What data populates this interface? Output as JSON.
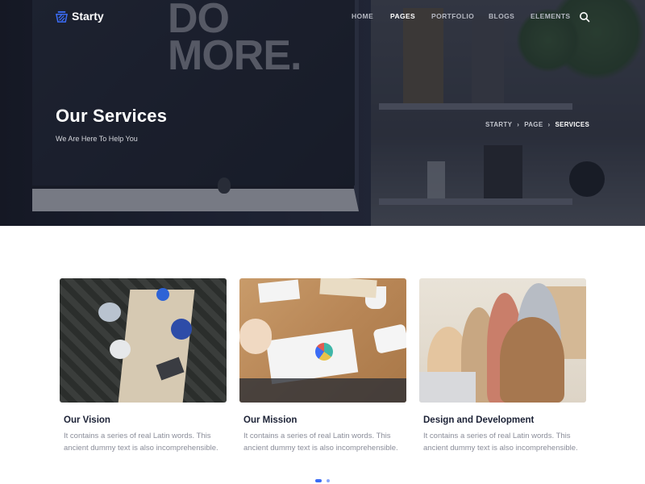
{
  "brand": {
    "name": "Starty",
    "accent": "#3b6cf5"
  },
  "nav": {
    "items": [
      {
        "label": "HOME",
        "active": false
      },
      {
        "label": "PAGES",
        "active": true
      },
      {
        "label": "PORTFOLIO",
        "active": false
      },
      {
        "label": "BLOGS",
        "active": false
      },
      {
        "label": "ELEMENTS",
        "active": false
      }
    ],
    "search_icon": "search-icon"
  },
  "hero": {
    "title": "Our Services",
    "subtitle": "We Are Here To Help You",
    "poster_text": "DO\nMORE.",
    "breadcrumb": [
      {
        "label": "STARTY"
      },
      {
        "label": "PAGE"
      },
      {
        "label": "SERVICES"
      }
    ]
  },
  "cards": [
    {
      "title": "Our Vision",
      "text": "It contains a series of real Latin words. This ancient dummy text is also incomprehensible."
    },
    {
      "title": "Our Mission",
      "text": "It contains a series of real Latin words. This ancient dummy text is also incomprehensible."
    },
    {
      "title": "Design and Development",
      "text": "It contains a series of real Latin words. This ancient dummy text is also incomprehensible."
    }
  ],
  "carousel": {
    "pages": 2,
    "active": 1
  }
}
